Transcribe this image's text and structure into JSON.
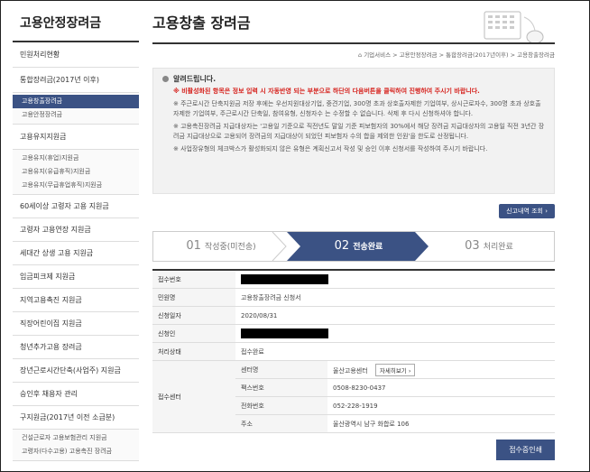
{
  "sidebar": {
    "title": "고용안정장려금",
    "items": [
      {
        "label": "민원처리현황"
      },
      {
        "label": "통합장려금(2017년 이후)"
      },
      {
        "label": "고용유지지원금"
      },
      {
        "label": "60세이상 고령자 고용 지원금"
      },
      {
        "label": "고령자 고용연장 지원금"
      },
      {
        "label": "세대간 상생 고용 지원금"
      },
      {
        "label": "임금피크제 지원금"
      },
      {
        "label": "지역고용촉진 지원금"
      },
      {
        "label": "직장어린이집 지원금"
      },
      {
        "label": "청년추가고용 장려금"
      },
      {
        "label": "장년근로시간단축(사업주) 지원금"
      },
      {
        "label": "승인후 채용자 관리"
      },
      {
        "label": "구지원금(2017년 이전 소급분)"
      }
    ],
    "sub_integrated": [
      "고용창출장려금",
      "고용안정장려금"
    ],
    "sub_retention": [
      "고용유지(휴업)지원금",
      "고용유지(유급휴직)지원금",
      "고용유지(무급휴업휴직)지원금"
    ],
    "sub_old": [
      "건설근로자 고용보험관리 지원금",
      "고령자(다수고용) 고용촉진 장려금"
    ]
  },
  "main": {
    "title": "고용창출 장려금",
    "breadcrumb": "기업서비스 > 고용안정장려금 > 통합장려금(2017년이후) > 고용창출장려금",
    "notice": {
      "heading": "알려드립니다.",
      "red_line": "※ 비활성화된 항목은 정보 입력 시 자동반영 되는 부분으로 하단의 다음버튼을 클릭하여 진행하여 주시기 바랍니다.",
      "line2": "※ 주근로시간 단축지원금 저장 후에는 우선지원대상기업, 중견기업, 300명 초과 상호출자제한 기업여부, 상시근로자수, 300명 초과 상호출자제한 기업여부, 주근로시간 단축일, 참여유형, 신청자수 는 수정할 수 없습니다. 삭제 후 다시 신청하셔야 합니다.",
      "line3": "※ 고용촉진장려금 지급대상자는 '고용일 기준으로 직전년도 말일 기준 피보험자의 30%에서 해당 장려금 지급대상자의 고용일 직전 3년간 장려금 지급대상으로 고용되어 장려금의 지급대상이 되었던 피보험자 수의 합을 제외한 인원'을 한도로 산정됩니다.",
      "line4": "※ 사업장유형의 체크박스가 활성화되지 않은 유형은 계획신고서 작성 및 승인 이후 신청서를 작성하여 주시기 바랍니다."
    },
    "history_button": "신고내역 조회",
    "steps": [
      {
        "num": "01",
        "label": "작성중(미전송)"
      },
      {
        "num": "02",
        "label": "전송완료"
      },
      {
        "num": "03",
        "label": "처리완료"
      }
    ],
    "table": {
      "receipt_no_label": "접수번호",
      "complaint_label": "민원명",
      "complaint_value": "고용창출장려금 신청서",
      "date_label": "신청일자",
      "date_value": "2020/08/31",
      "applicant_label": "신청인",
      "status_label": "처리상태",
      "status_value": "접수완료",
      "center_label": "접수센터",
      "center_name_label": "센터명",
      "center_name_value": "울산고용센터",
      "detail_button": "자세히보기",
      "fax_label": "팩스번호",
      "fax_value": "0508-8230-0437",
      "phone_label": "전화번호",
      "phone_value": "052-228-1919",
      "address_label": "주소",
      "address_value": "울산광역시 남구 화합로 106"
    },
    "print_button": "접수증인쇄"
  },
  "colors": {
    "accent": "#3b5284",
    "notice_red": "#d6221d"
  }
}
